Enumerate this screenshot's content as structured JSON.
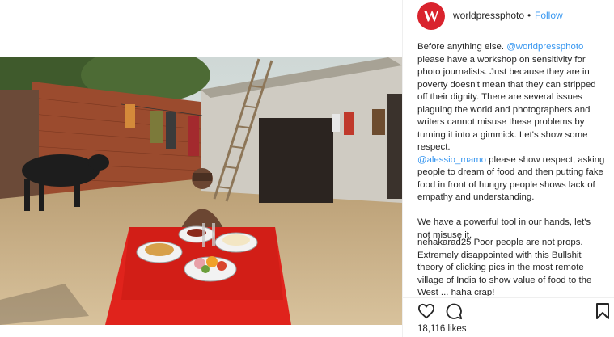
{
  "account": {
    "avatar_letter": "W",
    "username": "worldpressphoto",
    "separator": "•",
    "follow_label": "Follow",
    "brand_color": "#d9232d"
  },
  "caption": {
    "p1_before": "Before anything else. ",
    "p1_mention": "@worldpressphoto",
    "p1_after": " please have a workshop on sensitivity for photo journalists. Just because they are in poverty doesn't mean that they can stripped off their dignity. There are several issues plaguing the world and photographers and writers cannot misuse these problems by turning it into a gimmick. Let's show some respect.",
    "p2_mention": "@alessio_mamo",
    "p2_after": " please show respect, asking people to dream of food and then putting fake food in front of hungry people shows lack of empathy and understanding.",
    "p3": "We have a powerful tool in our hands, let's not misuse it."
  },
  "comment": {
    "username": "nehakarad25",
    "text": " Poor people are not props. Extremely disappointed with this Bullshit theory of clicking pics in the most remote village of India to show value of food to the West ... haha crap!"
  },
  "actions": {
    "like_icon": "heart-icon",
    "comment_icon": "comment-bubble-icon",
    "save_icon": "bookmark-icon"
  },
  "likes": {
    "text": "18,116 likes"
  },
  "photo": {
    "icon": "photo-village-scene",
    "tablecloth_color": "#e0231c",
    "ground_color": "#c9ad84"
  }
}
